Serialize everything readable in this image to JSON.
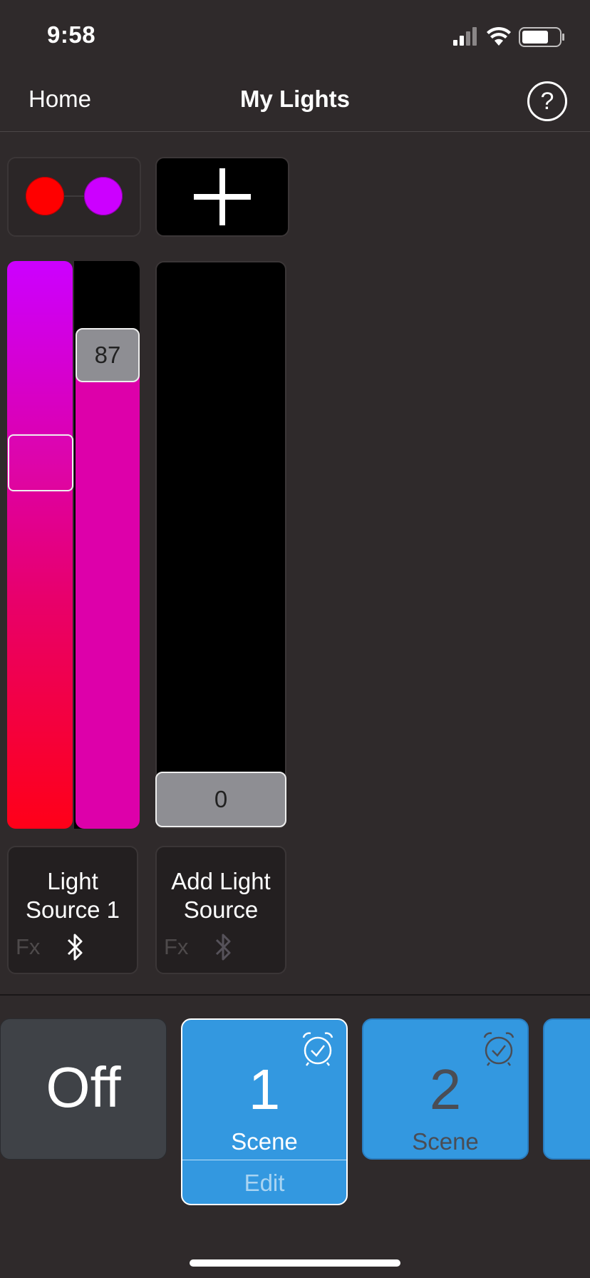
{
  "status": {
    "time": "9:58"
  },
  "nav": {
    "home_label": "Home",
    "title": "My Lights",
    "help_label": "?"
  },
  "colors": {
    "background": "#2f2a2b",
    "accent": "#3398e0",
    "red": "#ff0000",
    "purple": "#cc00ff",
    "magenta": "#dd00aa"
  },
  "light_sources": [
    {
      "name": "Light Source 1",
      "fx_label": "Fx",
      "brightness": 87,
      "bluetooth_icon": "bluetooth-icon"
    },
    {
      "name": "Add Light Source",
      "fx_label": "Fx",
      "brightness": 0,
      "bluetooth_icon": "bluetooth-icon"
    }
  ],
  "add_tile": {
    "icon": "plus-icon"
  },
  "scenes": {
    "off_label": "Off",
    "items": [
      {
        "number": "1",
        "label": "Scene",
        "edit_label": "Edit",
        "icon": "alarm-clock-icon"
      },
      {
        "number": "2",
        "label": "Scene",
        "icon": "alarm-clock-icon"
      }
    ]
  }
}
